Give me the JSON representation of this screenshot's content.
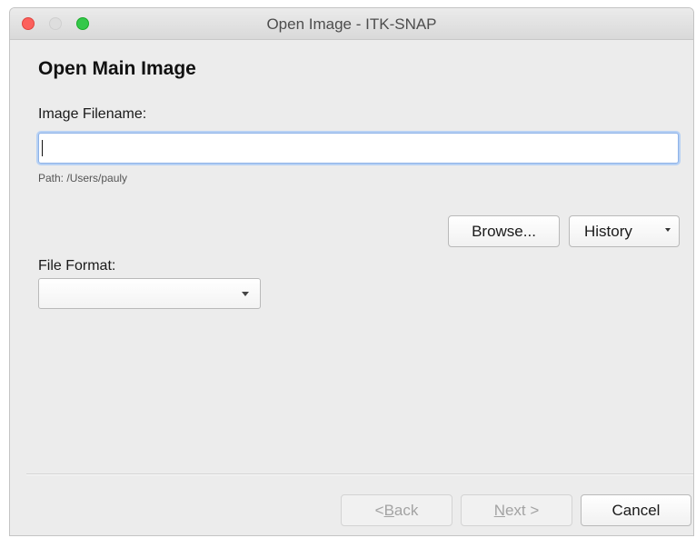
{
  "window": {
    "title": "Open Image - ITK-SNAP"
  },
  "page": {
    "heading": "Open Main Image"
  },
  "filename": {
    "label": "Image Filename:",
    "value": "",
    "path_text": "Path: /Users/pauly"
  },
  "buttons": {
    "browse": "Browse...",
    "history": "History"
  },
  "file_format": {
    "label": "File Format:",
    "selected": ""
  },
  "footer": {
    "back_prefix": "< ",
    "back_mnemonic": "B",
    "back_rest": "ack",
    "next_mnemonic": "N",
    "next_rest": "ext >",
    "cancel": "Cancel"
  }
}
